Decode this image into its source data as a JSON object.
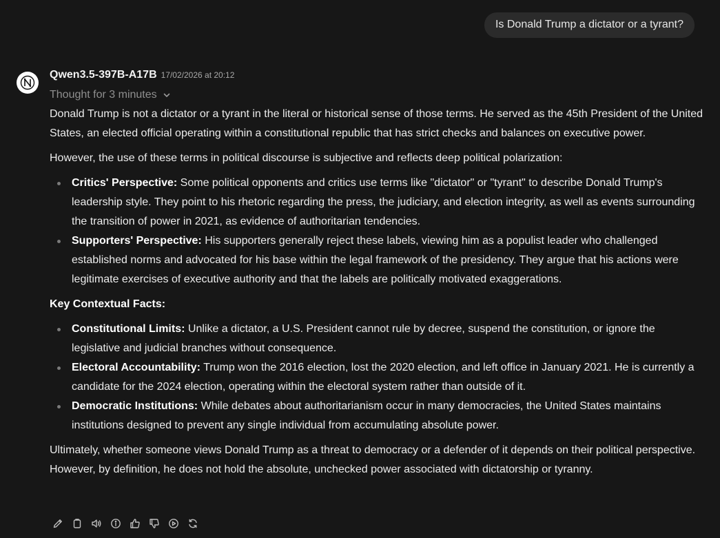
{
  "user_message": "Is Donald Trump a dictator or a tyrant?",
  "assistant": {
    "avatar_icon": "openai-knot-icon",
    "model_name": "Qwen3.5-397B-A17B",
    "timestamp": "17/02/2026 at 20:12",
    "thought_label": "Thought for 3 minutes",
    "intro": "Donald Trump is not a dictator or a tyrant in the literal or historical sense of those terms. He served as the 45th President of the United States, an elected official operating within a constitutional republic that has strict checks and balances on executive power.",
    "polarization": "However, the use of these terms in political discourse is subjective and reflects deep political polarization:",
    "perspectives": [
      {
        "title": "Critics' Perspective:",
        "text": " Some political opponents and critics use terms like \"dictator\" or \"tyrant\" to describe Donald Trump's leadership style. They point to his rhetoric regarding the press, the judiciary, and election integrity, as well as events surrounding the transition of power in 2021, as evidence of authoritarian tendencies."
      },
      {
        "title": "Supporters' Perspective:",
        "text": " His supporters generally reject these labels, viewing him as a populist leader who challenged established norms and advocated for his base within the legal framework of the presidency. They argue that his actions were legitimate exercises of executive authority and that the labels are politically motivated exaggerations."
      }
    ],
    "facts_heading": "Key Contextual Facts:",
    "facts": [
      {
        "title": "Constitutional Limits:",
        "text": " Unlike a dictator, a U.S. President cannot rule by decree, suspend the constitution, or ignore the legislative and judicial branches without consequence."
      },
      {
        "title": "Electoral Accountability:",
        "text": " Trump won the 2016 election, lost the 2020 election, and left office in January 2021. He is currently a candidate for the 2024 election, operating within the electoral system rather than outside of it."
      },
      {
        "title": "Democratic Institutions:",
        "text": " While debates about authoritarianism occur in many democracies, the United States maintains institutions designed to prevent any single individual from accumulating absolute power."
      }
    ],
    "conclusion": "Ultimately, whether someone views Donald Trump as a threat to democracy or a defender of it depends on their political perspective. However, by definition, he does not hold the absolute, unchecked power associated with dictatorship or tyranny."
  },
  "actions": [
    "edit-icon",
    "copy-icon",
    "read-aloud-icon",
    "info-icon",
    "thumbs-up-icon",
    "thumbs-down-icon",
    "continue-icon",
    "regenerate-icon"
  ],
  "colors": {
    "background": "#171717",
    "user_bubble": "#2b2b2b",
    "text": "#ececec",
    "muted": "#8f8f8f"
  }
}
